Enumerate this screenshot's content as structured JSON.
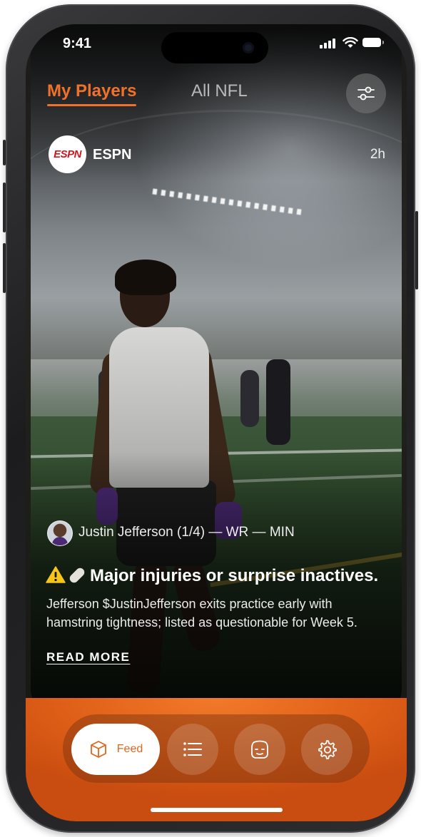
{
  "status_bar": {
    "time": "9:41"
  },
  "tabs": [
    {
      "label": "My Players",
      "active": true
    },
    {
      "label": "All NFL",
      "active": false
    }
  ],
  "post": {
    "source": {
      "name": "ESPN",
      "logo_text": "ESPN",
      "time": "2h"
    },
    "player_tag": "Justin Jefferson (1/4) — WR — MIN",
    "headline": "Major injuries or surprise inactives.",
    "headline_icons": [
      "warning-icon",
      "bandage-icon"
    ],
    "summary": "Jefferson $JustinJefferson exits practice early with hamstring tightness; listed as questionable for Week 5.",
    "read_more": "READ MORE"
  },
  "nav": {
    "items": [
      {
        "label": "Feed",
        "icon": "cube-icon",
        "active": true
      },
      {
        "label": "",
        "icon": "list-icon",
        "active": false
      },
      {
        "label": "",
        "icon": "helmet-icon",
        "active": false
      },
      {
        "label": "",
        "icon": "gear-icon",
        "active": false
      }
    ]
  },
  "colors": {
    "accent": "#f0722a",
    "nav_background": "#de5e17",
    "espn_red": "#d2161e"
  }
}
